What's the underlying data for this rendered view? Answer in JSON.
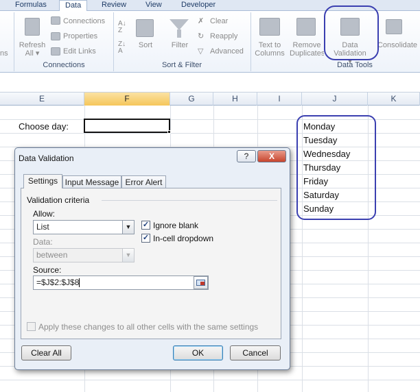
{
  "ribbon": {
    "tabs": [
      {
        "label": "Formulas",
        "active": false
      },
      {
        "label": "Data",
        "active": true
      },
      {
        "label": "Review",
        "active": false
      },
      {
        "label": "View",
        "active": false
      },
      {
        "label": "Developer",
        "active": false
      }
    ],
    "connections_group": {
      "label": "Connections",
      "cut_label": "ns",
      "refresh_all_line1": "Refresh",
      "refresh_all_line2": "All",
      "connections": "Connections",
      "properties": "Properties",
      "edit_links": "Edit Links"
    },
    "sort_filter_group": {
      "label": "Sort & Filter",
      "sort": "Sort",
      "filter": "Filter",
      "clear": "Clear",
      "reapply": "Reapply",
      "advanced": "Advanced"
    },
    "data_tools_group": {
      "label": "Data Tools",
      "text_to_columns_line1": "Text to",
      "text_to_columns_line2": "Columns",
      "remove_duplicates_line1": "Remove",
      "remove_duplicates_line2": "Duplicates",
      "data_validation_line1": "Data",
      "data_validation_line2": "Validation",
      "consolidate": "Consolidate"
    },
    "annotation_color": "#3a3fb0"
  },
  "sheet": {
    "columns": [
      "E",
      "F",
      "G",
      "H",
      "I",
      "J",
      "K"
    ],
    "selected_column": "F",
    "prompt_label": "Choose day:",
    "day_list": [
      "Monday",
      "Tuesday",
      "Wednesday",
      "Thursday",
      "Friday",
      "Saturday",
      "Sunday"
    ]
  },
  "dialog": {
    "title": "Data Validation",
    "help_button": "?",
    "close_button": "X",
    "tabs": [
      {
        "label": "Settings",
        "active": true
      },
      {
        "label": "Input Message",
        "active": false
      },
      {
        "label": "Error Alert",
        "active": false
      }
    ],
    "criteria_heading": "Validation criteria",
    "allow_label": "Allow:",
    "allow_value": "List",
    "ignore_blank": {
      "label": "Ignore blank",
      "checked": true
    },
    "in_cell_dropdown": {
      "label": "In-cell dropdown",
      "checked": true
    },
    "data_label": "Data:",
    "data_value": "between",
    "source_label": "Source:",
    "source_value": "=$J$2:$J$8",
    "apply_all": {
      "label": "Apply these changes to all other cells with the same settings",
      "checked": false
    },
    "clear_all_button": "Clear All",
    "ok_button": "OK",
    "cancel_button": "Cancel"
  }
}
